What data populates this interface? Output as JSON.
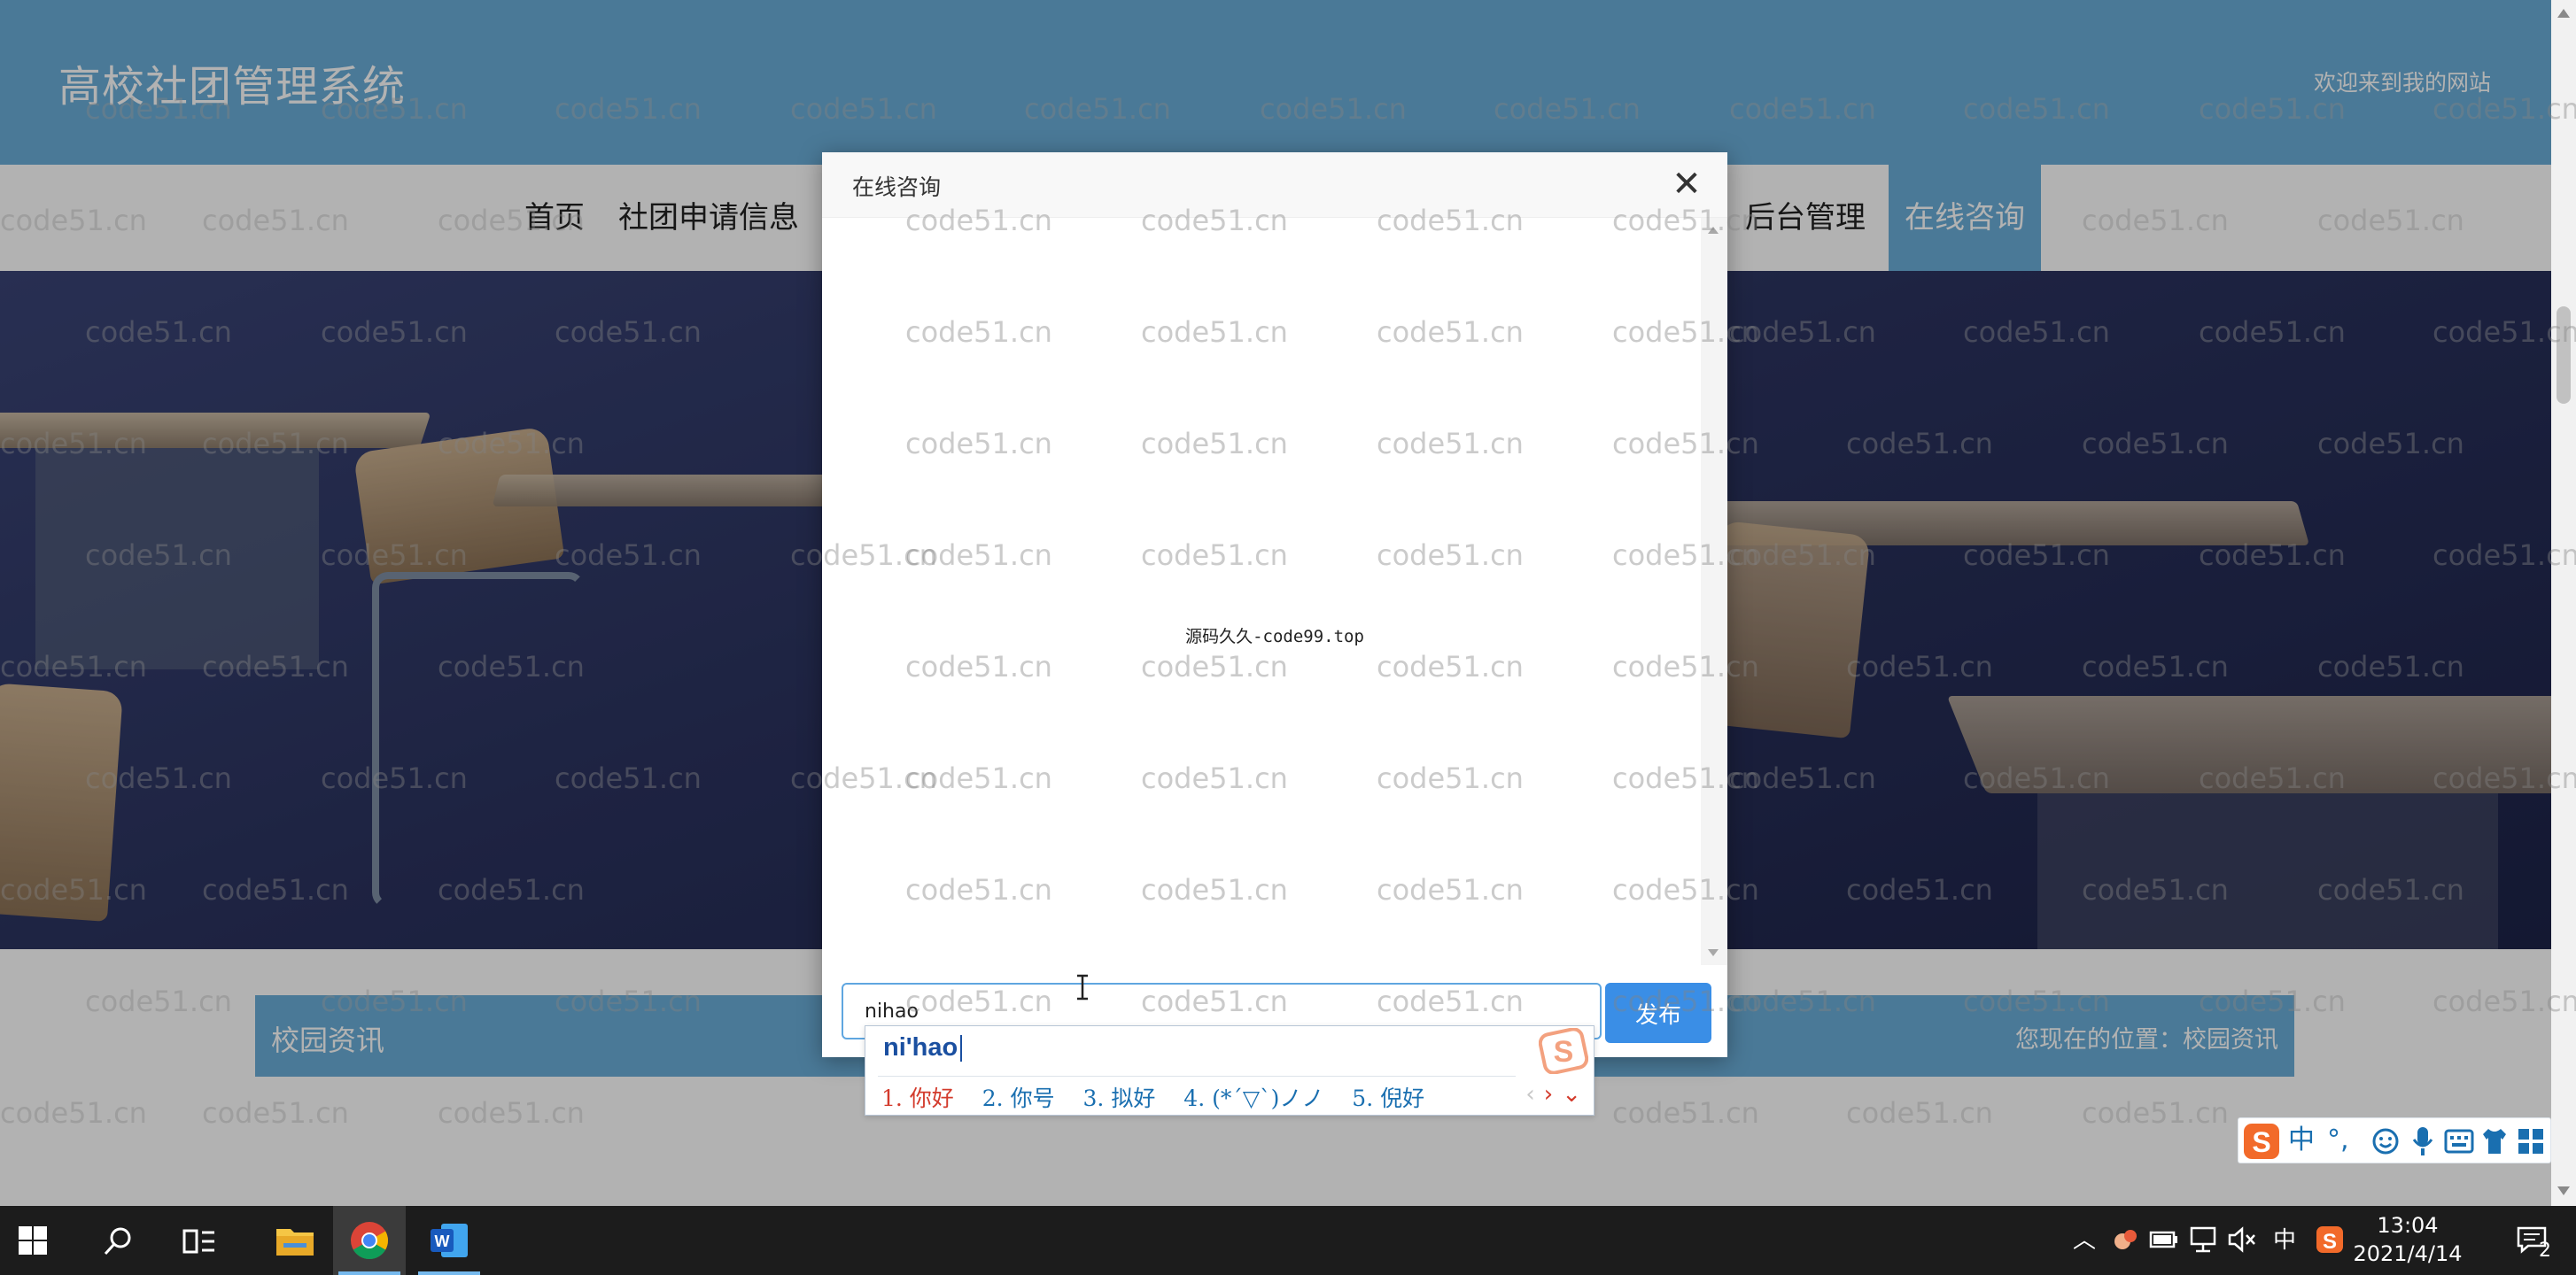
{
  "header": {
    "site_title": "高校社团管理系统",
    "welcome": "欢迎来到我的网站"
  },
  "nav": {
    "items": [
      "首页",
      "社团申请信息",
      "后台管理",
      "在线咨询"
    ],
    "active": "在线咨询"
  },
  "section": {
    "title": "校园资讯",
    "breadcrumb": "您现在的位置：校园资讯"
  },
  "dialog": {
    "title": "在线咨询",
    "close_glyph": "✕",
    "watermark_label": "源码久久-code99.top",
    "input_value": "nihao",
    "publish_label": "发布"
  },
  "ime": {
    "pinyin": "ni'hao",
    "candidates": [
      "1. 你好",
      "2. 你号",
      "3. 拟好",
      "4. (*´▽`)ノノ",
      "5. 倪好"
    ],
    "toolbar": {
      "lang": "中",
      "punct": "°,"
    }
  },
  "watermark_text": "code51.cn",
  "taskbar": {
    "time": "13:04",
    "date": "2021/4/14",
    "input_lang": "中",
    "notifications": "2"
  },
  "colors": {
    "header_blue": "#6aaed8",
    "primary_button": "#3a8ee6",
    "ime_selected": "#d33b2c",
    "ime_candidate": "#1a6fb0"
  }
}
